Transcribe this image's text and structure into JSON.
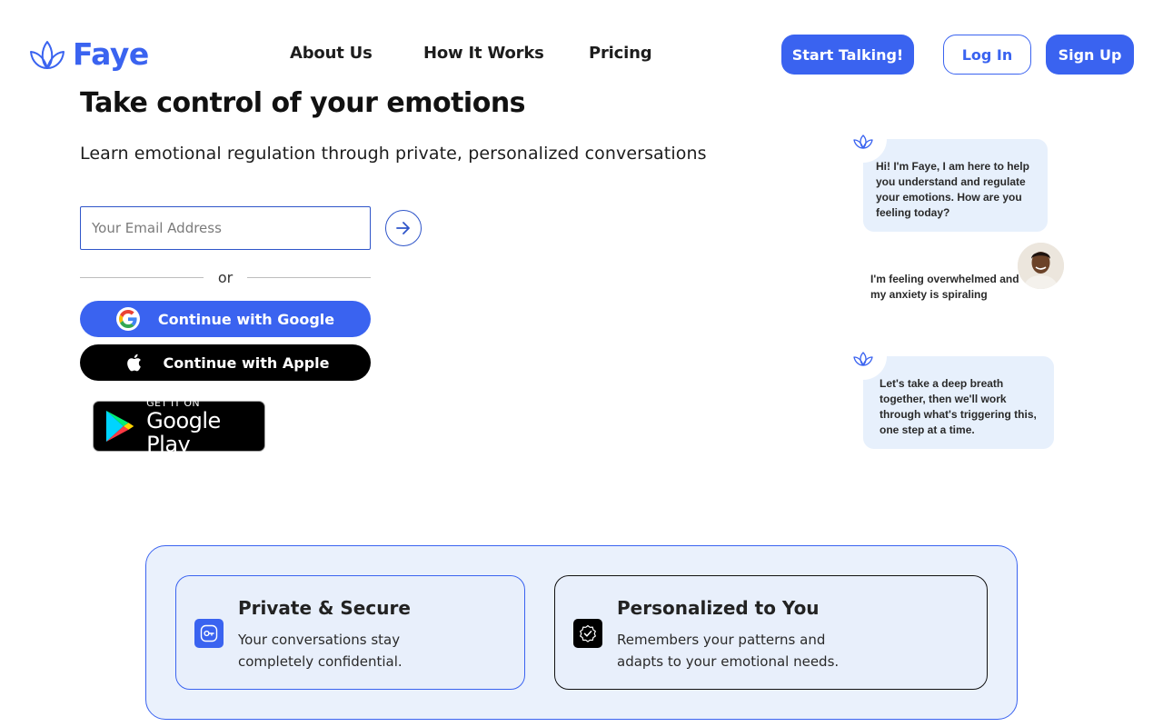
{
  "brand": {
    "name": "Faye",
    "logo_icon": "lotus-icon",
    "accent": "#3a63f0"
  },
  "nav": {
    "links": [
      "About Us",
      "How It Works",
      "Pricing"
    ],
    "start_label": "Start Talking!",
    "login_label": "Log In",
    "signup_label": "Sign Up"
  },
  "hero": {
    "title": "Take control of your emotions",
    "subtitle": "Learn emotional regulation through private, personalized conversations",
    "email_placeholder": "Your Email Address",
    "email_value": "",
    "submit_icon": "arrow-right-icon",
    "or_text": "or",
    "google_label": "Continue with Google",
    "apple_label": "Continue with Apple",
    "play_badge": {
      "top": "GET IT ON",
      "bottom": "Google Play"
    }
  },
  "chat": {
    "bot_intro": "Hi! I'm Faye, I am here to help you understand and regulate your emotions. How are you feeling today?",
    "user_message": "I'm feeling overwhelmed and my anxiety is spiraling",
    "bot_reply": "Let's take a deep breath together, then we'll work through what's triggering this, one step at a time."
  },
  "features": [
    {
      "title": "Private & Secure",
      "description": "Your conversations stay completely confidential.",
      "icon": "key-icon"
    },
    {
      "title": "Personalized to You",
      "description": "Remembers your patterns and adapts to your emotional needs.",
      "icon": "check-badge-icon"
    }
  ]
}
